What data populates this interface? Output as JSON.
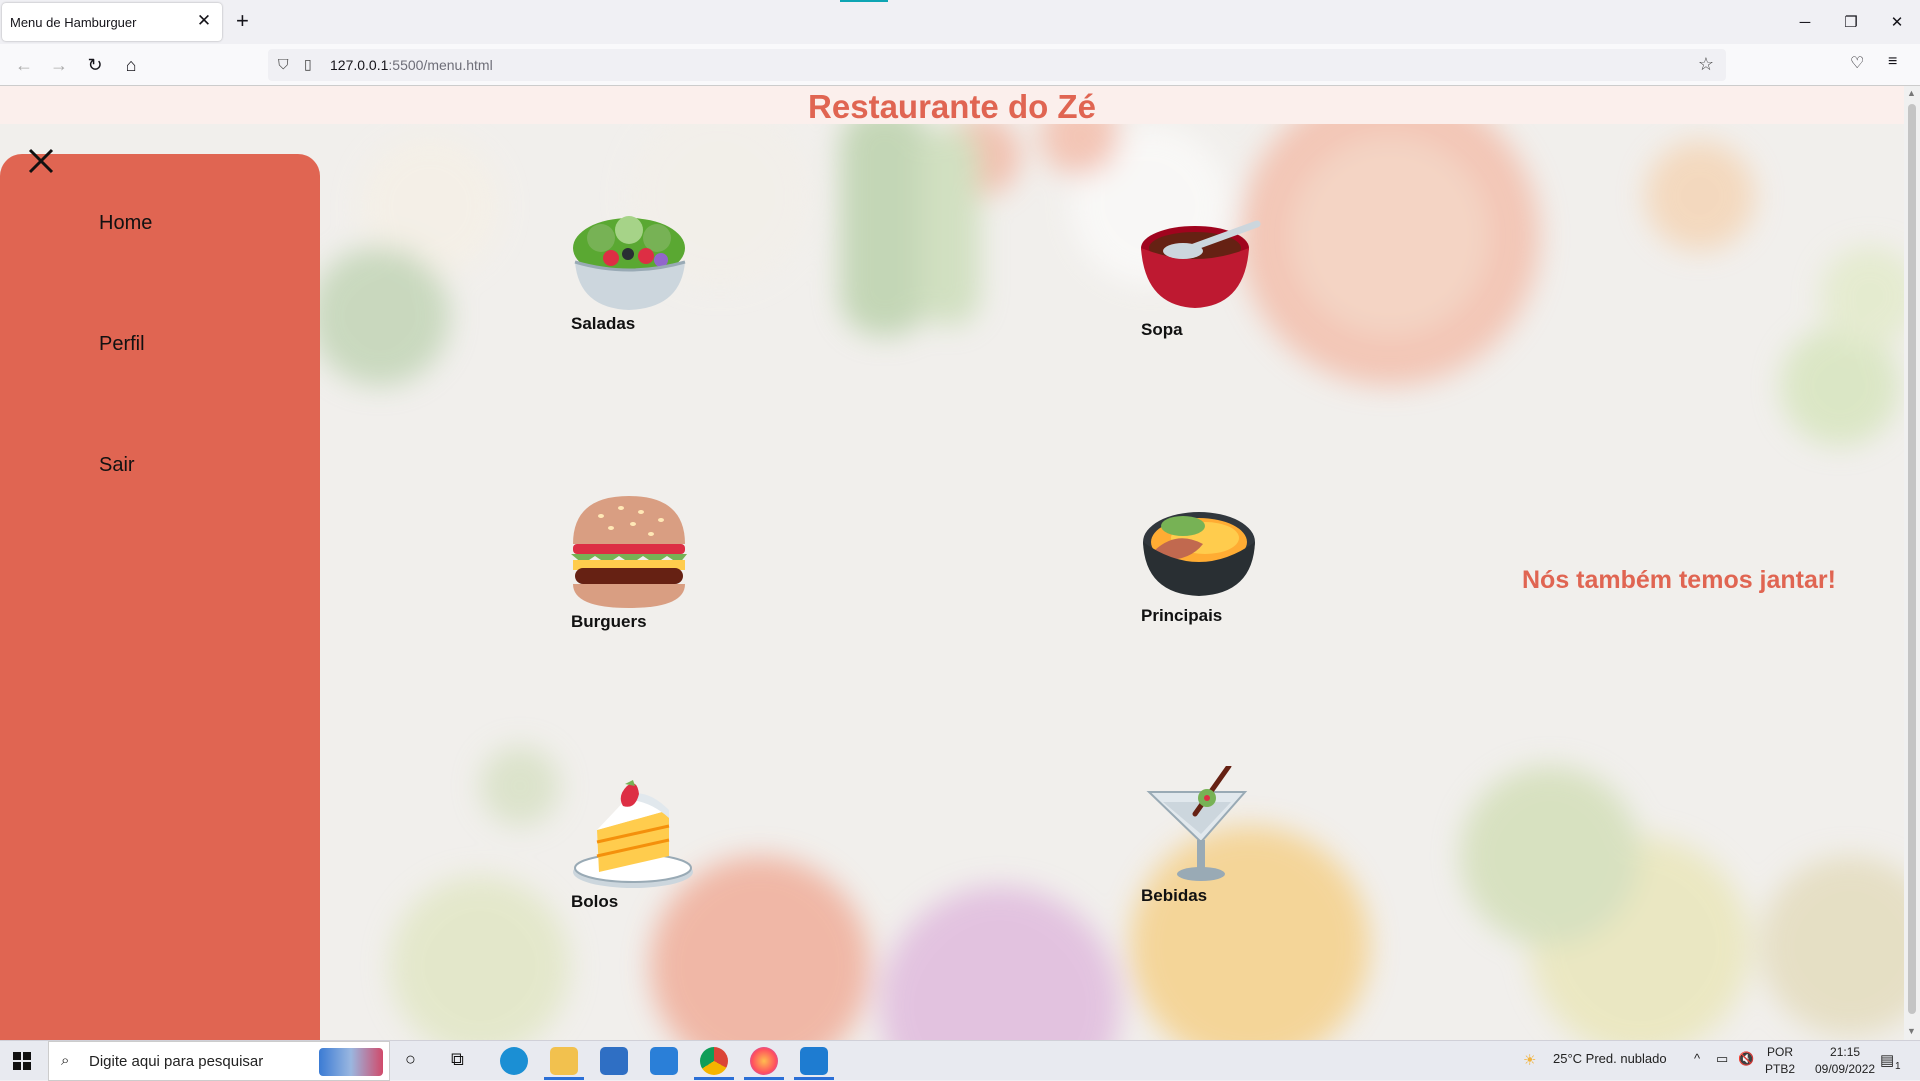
{
  "browser": {
    "tab_title": "Menu de Hamburguer",
    "tab_close": "✕",
    "new_tab": "+",
    "url_host": "127.0.0.1",
    "url_rest": ":5500/menu.html",
    "window_controls": {
      "minimize": "─",
      "restore": "❐",
      "close": "✕"
    }
  },
  "page": {
    "title": "Restaurante do Zé",
    "sidebar": {
      "items": [
        {
          "label": "Home"
        },
        {
          "label": "Perfil"
        },
        {
          "label": "Sair"
        }
      ]
    },
    "menu": [
      {
        "label": "Saladas",
        "icon": "salad-icon"
      },
      {
        "label": "Sopa",
        "icon": "soup-bowl-icon"
      },
      {
        "label": "Burguers",
        "icon": "hamburger-icon"
      },
      {
        "label": "Principais",
        "icon": "shallow-pan-icon"
      },
      {
        "label": "Bolos",
        "icon": "cake-slice-icon"
      },
      {
        "label": "Bebidas",
        "icon": "cocktail-icon"
      }
    ],
    "dinner_text": "Nós também temos jantar!",
    "colors": {
      "accent": "#e06552",
      "header": "#fbefec"
    }
  },
  "taskbar": {
    "search_placeholder": "Digite aqui para pesquisar",
    "weather": "25°C  Pred. nublado",
    "language_top": "POR",
    "language_bottom": "PTB2",
    "time": "21:15",
    "date": "09/09/2022",
    "notification_count": "1"
  }
}
